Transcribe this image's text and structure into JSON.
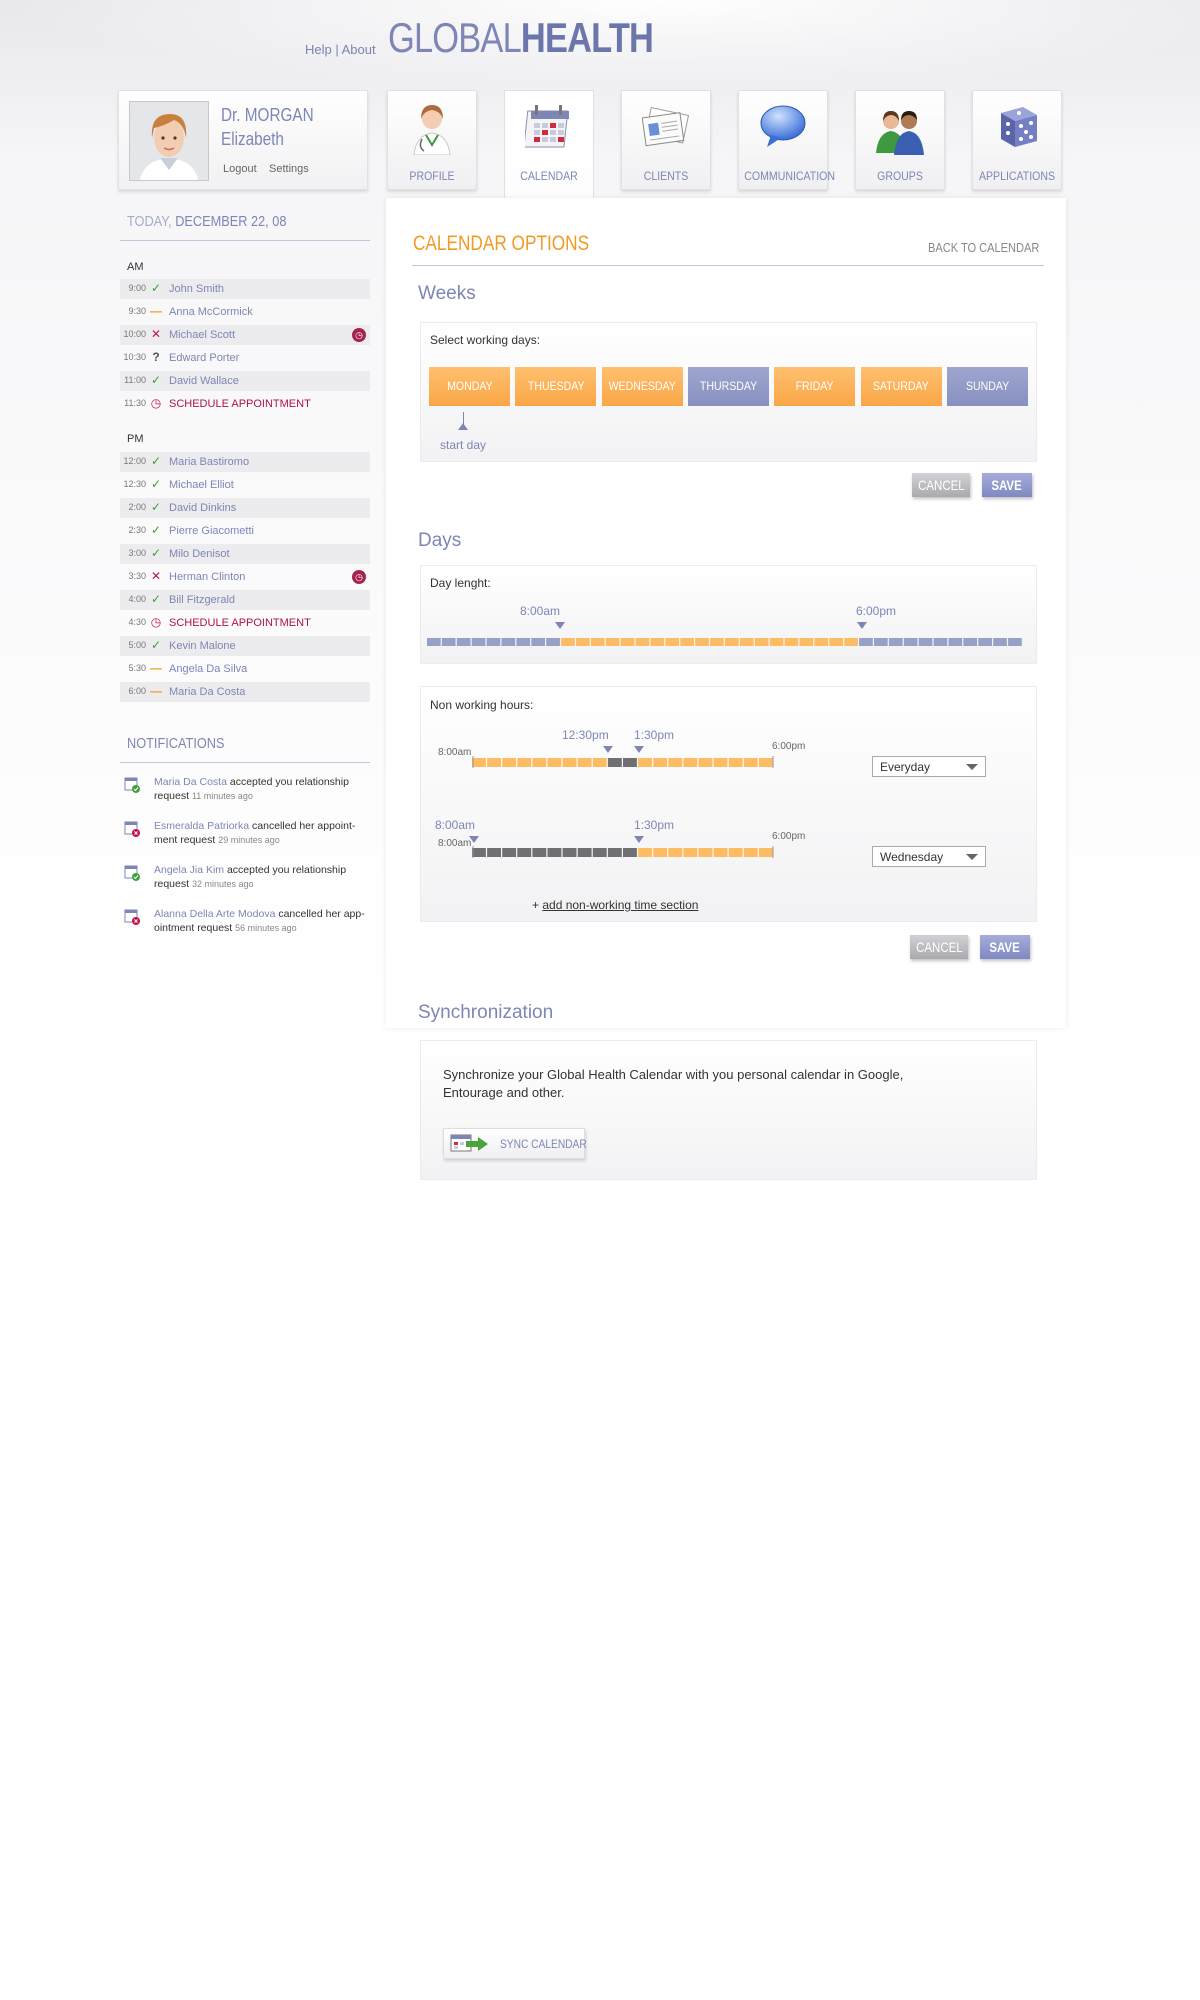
{
  "header": {
    "help": "Help",
    "about": "About",
    "logo_light": "GLOBAL",
    "logo_bold": "HEALTH"
  },
  "profile": {
    "name_line1": "Dr. MORGAN",
    "name_line2": "Elizabeth",
    "logout": "Logout",
    "settings": "Settings"
  },
  "nav": {
    "tabs": [
      {
        "label": "PROFILE",
        "icon": "doctor-icon"
      },
      {
        "label": "CALENDAR",
        "icon": "calendar-icon",
        "active": true
      },
      {
        "label": "CLIENTS",
        "icon": "contact-card-icon"
      },
      {
        "label": "COMMUNICATION",
        "icon": "speech-bubble-icon"
      },
      {
        "label": "GROUPS",
        "icon": "people-icon"
      },
      {
        "label": "APPLICATIONS",
        "icon": "dice-icon"
      }
    ]
  },
  "sidebar": {
    "today_label": "TODAY,",
    "today_date": "DECEMBER 22, 08",
    "am_label": "AM",
    "pm_label": "PM",
    "am": [
      {
        "time": "9:00",
        "status": "confirmed",
        "name": "John Smith"
      },
      {
        "time": "9:30",
        "status": "pending",
        "name": "Anna McCormick"
      },
      {
        "time": "10:00",
        "status": "cancelled",
        "name": "Michael Scott",
        "alarm": true
      },
      {
        "time": "10:30",
        "status": "unknown",
        "name": "Edward Porter"
      },
      {
        "time": "11:00",
        "status": "confirmed",
        "name": "David Wallace"
      },
      {
        "time": "11:30",
        "status": "schedule",
        "name": "SCHEDULE APPOINTMENT"
      }
    ],
    "pm": [
      {
        "time": "12:00",
        "status": "confirmed",
        "name": "Maria Bastiromo"
      },
      {
        "time": "12:30",
        "status": "confirmed",
        "name": "Michael Elliot"
      },
      {
        "time": "2:00",
        "status": "confirmed",
        "name": "David Dinkins"
      },
      {
        "time": "2:30",
        "status": "confirmed",
        "name": "Pierre Giacometti"
      },
      {
        "time": "3:00",
        "status": "confirmed",
        "name": "Milo Denisot"
      },
      {
        "time": "3:30",
        "status": "cancelled",
        "name": "Herman Clinton",
        "alarm": true
      },
      {
        "time": "4:00",
        "status": "confirmed",
        "name": "Bill Fitzgerald"
      },
      {
        "time": "4:30",
        "status": "schedule",
        "name": "SCHEDULE APPOINTMENT"
      },
      {
        "time": "5:00",
        "status": "confirmed",
        "name": "Kevin Malone"
      },
      {
        "time": "5:30",
        "status": "pending",
        "name": "Angela Da Silva"
      },
      {
        "time": "6:00",
        "status": "pending",
        "name": "Maria Da Costa"
      }
    ],
    "notifications_title": "NOTIFICATIONS",
    "notifications": [
      {
        "who": "Maria Da Costa",
        "text": " accepted you relationship request ",
        "ago": "11 minutes ago",
        "type": "accepted"
      },
      {
        "who": "Esmeralda Patriorka",
        "text": " cancelled her appoint-ment request ",
        "ago": "29 minutes ago",
        "type": "cancelled"
      },
      {
        "who": "Angela Jia Kim",
        "text": " accepted you relationship request ",
        "ago": "32 minutes ago",
        "type": "accepted"
      },
      {
        "who": "Alanna Della Arte Modova",
        "text": " cancelled her app-ointment request ",
        "ago": "56 minutes ago",
        "type": "cancelled"
      }
    ]
  },
  "main": {
    "title": "CALENDAR OPTIONS",
    "back": "BACK TO CALENDAR",
    "weeks": {
      "heading": "Weeks",
      "label": "Select working days:",
      "days": [
        {
          "label": "MONDAY",
          "on": true
        },
        {
          "label": "THUESDAY",
          "on": true
        },
        {
          "label": "WEDNESDAY",
          "on": true
        },
        {
          "label": "THURSDAY",
          "on": false
        },
        {
          "label": "FRIDAY",
          "on": true
        },
        {
          "label": "SATURDAY",
          "on": true
        },
        {
          "label": "SUNDAY",
          "on": false
        }
      ],
      "start_day": "start day",
      "cancel": "CANCEL",
      "save": "SAVE"
    },
    "days": {
      "heading": "Days",
      "day_length_label": "Day lenght:",
      "start_time": "8:00am",
      "end_time": "6:00pm",
      "non_working_label": "Non working hours:",
      "row1": {
        "start": "8:00am",
        "end": "6:00pm",
        "break_start": "12:30pm",
        "break_end": "1:30pm",
        "select": "Everyday"
      },
      "row2": {
        "start": "8:00am",
        "end": "6:00pm",
        "marker_start": "8:00am",
        "marker_end": "1:30pm",
        "select": "Wednesday"
      },
      "add_prefix": "+ ",
      "add_link": "add non-working time section",
      "cancel": "CANCEL",
      "save": "SAVE"
    },
    "sync": {
      "heading": "Synchronization",
      "text": "Synchronize your Global Health Calendar with you personal calendar in Google, Entourage and other.",
      "button": "SYNC CALENDAR"
    }
  },
  "colors": {
    "accent": "#7d86b5",
    "orange": "#f39a22",
    "confirmed": "#35a335",
    "cancelled": "#c4124d"
  }
}
